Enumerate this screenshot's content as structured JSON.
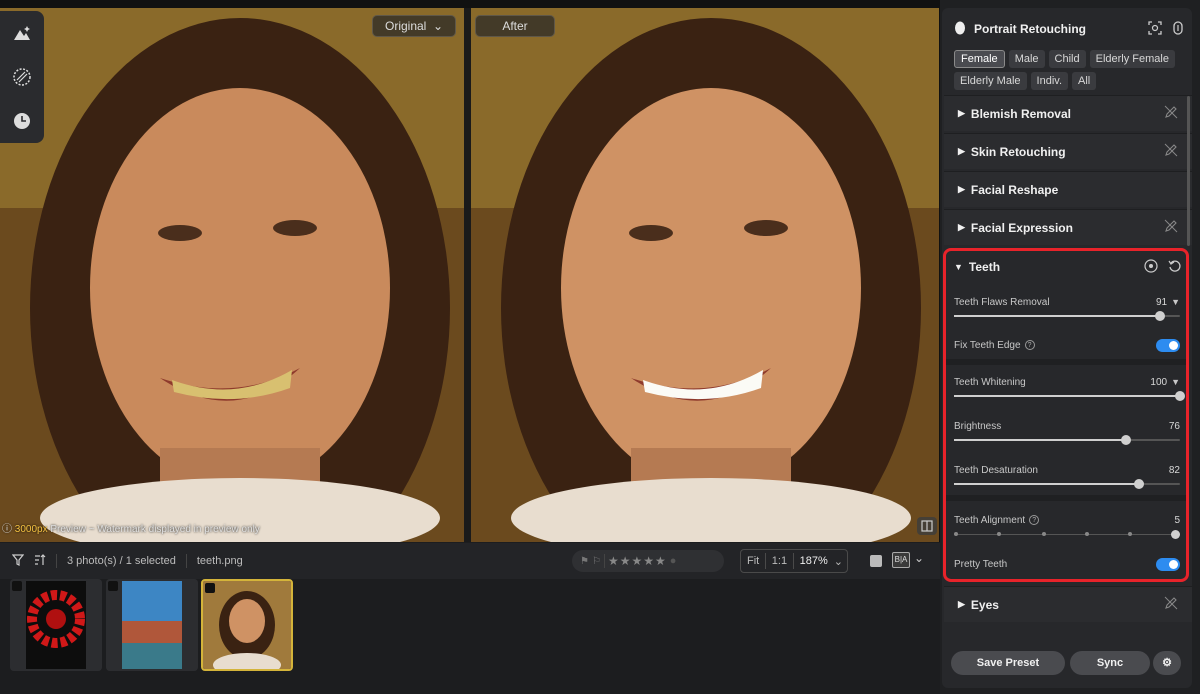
{
  "viewer": {
    "original_label": "Original",
    "after_label": "After",
    "watermark_highlight": "3000px",
    "watermark_rest": " Preview ~ Watermark displayed in preview only"
  },
  "tool_rail": [
    "landscape-sparkle-icon",
    "texture-brush-icon",
    "history-clock-icon"
  ],
  "toolbar": {
    "selection_info": "3 photo(s) / 1 selected",
    "filename": "teeth.png",
    "zoom_fit": "Fit",
    "zoom_1to1": "1:1",
    "zoom_level": "187%",
    "ba_label": "B|A"
  },
  "filmstrip": {
    "thumbs": [
      {
        "name": "red-spiral-photo",
        "selected": false
      },
      {
        "name": "lakeside-buildings-photo",
        "selected": false
      },
      {
        "name": "woman-smiling-photo",
        "selected": true
      }
    ]
  },
  "panel": {
    "title": "Portrait Retouching",
    "chips": [
      "Female",
      "Male",
      "Child",
      "Elderly Female",
      "Elderly Male",
      "Indiv.",
      "All"
    ],
    "active_chip": "Female",
    "sections_top": [
      "Blemish Removal",
      "Skin Retouching",
      "Facial Reshape",
      "Facial Expression"
    ],
    "teeth": {
      "title": "Teeth",
      "flaws_label": "Teeth Flaws Removal",
      "flaws_value": "91",
      "fix_edge_label": "Fix Teeth Edge",
      "whitening_label": "Teeth Whitening",
      "whitening_value": "100",
      "brightness_label": "Brightness",
      "brightness_value": "76",
      "desat_label": "Teeth Desaturation",
      "desat_value": "82",
      "alignment_label": "Teeth Alignment",
      "alignment_value": "5",
      "pretty_label": "Pretty Teeth"
    },
    "eyes_label": "Eyes",
    "save_preset": "Save Preset",
    "sync": "Sync"
  },
  "colors": {
    "highlight_border": "#e8232a",
    "toggle_on": "#2d8cf0",
    "selected_thumb": "#d4b43a"
  }
}
